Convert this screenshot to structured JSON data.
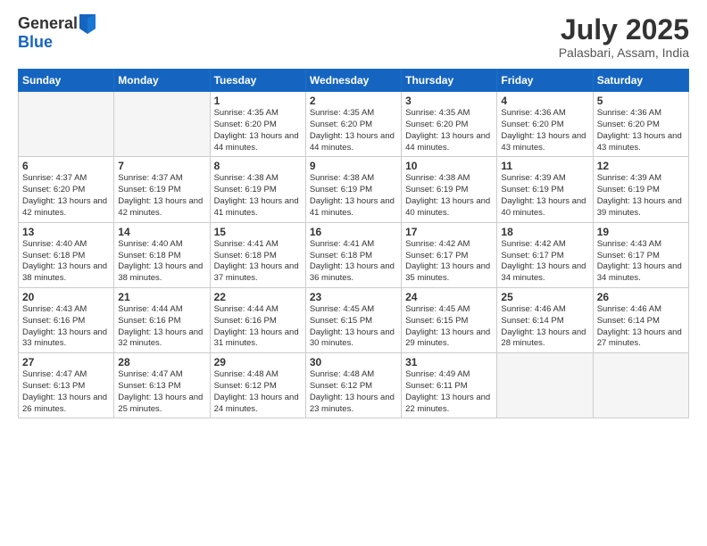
{
  "logo": {
    "general": "General",
    "blue": "Blue"
  },
  "title": "July 2025",
  "location": "Palasbari, Assam, India",
  "weekdays": [
    "Sunday",
    "Monday",
    "Tuesday",
    "Wednesday",
    "Thursday",
    "Friday",
    "Saturday"
  ],
  "weeks": [
    [
      {
        "day": "",
        "info": ""
      },
      {
        "day": "",
        "info": ""
      },
      {
        "day": "1",
        "info": "Sunrise: 4:35 AM\nSunset: 6:20 PM\nDaylight: 13 hours and 44 minutes."
      },
      {
        "day": "2",
        "info": "Sunrise: 4:35 AM\nSunset: 6:20 PM\nDaylight: 13 hours and 44 minutes."
      },
      {
        "day": "3",
        "info": "Sunrise: 4:35 AM\nSunset: 6:20 PM\nDaylight: 13 hours and 44 minutes."
      },
      {
        "day": "4",
        "info": "Sunrise: 4:36 AM\nSunset: 6:20 PM\nDaylight: 13 hours and 43 minutes."
      },
      {
        "day": "5",
        "info": "Sunrise: 4:36 AM\nSunset: 6:20 PM\nDaylight: 13 hours and 43 minutes."
      }
    ],
    [
      {
        "day": "6",
        "info": "Sunrise: 4:37 AM\nSunset: 6:20 PM\nDaylight: 13 hours and 42 minutes."
      },
      {
        "day": "7",
        "info": "Sunrise: 4:37 AM\nSunset: 6:19 PM\nDaylight: 13 hours and 42 minutes."
      },
      {
        "day": "8",
        "info": "Sunrise: 4:38 AM\nSunset: 6:19 PM\nDaylight: 13 hours and 41 minutes."
      },
      {
        "day": "9",
        "info": "Sunrise: 4:38 AM\nSunset: 6:19 PM\nDaylight: 13 hours and 41 minutes."
      },
      {
        "day": "10",
        "info": "Sunrise: 4:38 AM\nSunset: 6:19 PM\nDaylight: 13 hours and 40 minutes."
      },
      {
        "day": "11",
        "info": "Sunrise: 4:39 AM\nSunset: 6:19 PM\nDaylight: 13 hours and 40 minutes."
      },
      {
        "day": "12",
        "info": "Sunrise: 4:39 AM\nSunset: 6:19 PM\nDaylight: 13 hours and 39 minutes."
      }
    ],
    [
      {
        "day": "13",
        "info": "Sunrise: 4:40 AM\nSunset: 6:18 PM\nDaylight: 13 hours and 38 minutes."
      },
      {
        "day": "14",
        "info": "Sunrise: 4:40 AM\nSunset: 6:18 PM\nDaylight: 13 hours and 38 minutes."
      },
      {
        "day": "15",
        "info": "Sunrise: 4:41 AM\nSunset: 6:18 PM\nDaylight: 13 hours and 37 minutes."
      },
      {
        "day": "16",
        "info": "Sunrise: 4:41 AM\nSunset: 6:18 PM\nDaylight: 13 hours and 36 minutes."
      },
      {
        "day": "17",
        "info": "Sunrise: 4:42 AM\nSunset: 6:17 PM\nDaylight: 13 hours and 35 minutes."
      },
      {
        "day": "18",
        "info": "Sunrise: 4:42 AM\nSunset: 6:17 PM\nDaylight: 13 hours and 34 minutes."
      },
      {
        "day": "19",
        "info": "Sunrise: 4:43 AM\nSunset: 6:17 PM\nDaylight: 13 hours and 34 minutes."
      }
    ],
    [
      {
        "day": "20",
        "info": "Sunrise: 4:43 AM\nSunset: 6:16 PM\nDaylight: 13 hours and 33 minutes."
      },
      {
        "day": "21",
        "info": "Sunrise: 4:44 AM\nSunset: 6:16 PM\nDaylight: 13 hours and 32 minutes."
      },
      {
        "day": "22",
        "info": "Sunrise: 4:44 AM\nSunset: 6:16 PM\nDaylight: 13 hours and 31 minutes."
      },
      {
        "day": "23",
        "info": "Sunrise: 4:45 AM\nSunset: 6:15 PM\nDaylight: 13 hours and 30 minutes."
      },
      {
        "day": "24",
        "info": "Sunrise: 4:45 AM\nSunset: 6:15 PM\nDaylight: 13 hours and 29 minutes."
      },
      {
        "day": "25",
        "info": "Sunrise: 4:46 AM\nSunset: 6:14 PM\nDaylight: 13 hours and 28 minutes."
      },
      {
        "day": "26",
        "info": "Sunrise: 4:46 AM\nSunset: 6:14 PM\nDaylight: 13 hours and 27 minutes."
      }
    ],
    [
      {
        "day": "27",
        "info": "Sunrise: 4:47 AM\nSunset: 6:13 PM\nDaylight: 13 hours and 26 minutes."
      },
      {
        "day": "28",
        "info": "Sunrise: 4:47 AM\nSunset: 6:13 PM\nDaylight: 13 hours and 25 minutes."
      },
      {
        "day": "29",
        "info": "Sunrise: 4:48 AM\nSunset: 6:12 PM\nDaylight: 13 hours and 24 minutes."
      },
      {
        "day": "30",
        "info": "Sunrise: 4:48 AM\nSunset: 6:12 PM\nDaylight: 13 hours and 23 minutes."
      },
      {
        "day": "31",
        "info": "Sunrise: 4:49 AM\nSunset: 6:11 PM\nDaylight: 13 hours and 22 minutes."
      },
      {
        "day": "",
        "info": ""
      },
      {
        "day": "",
        "info": ""
      }
    ]
  ]
}
